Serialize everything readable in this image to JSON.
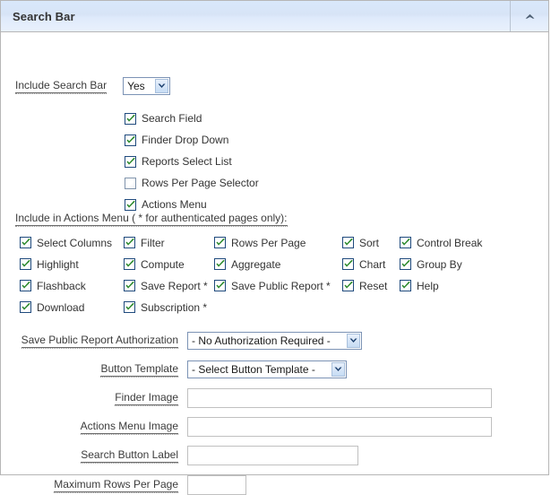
{
  "region": {
    "title": "Search Bar",
    "collapse_icon": "chevron-up-icon"
  },
  "include_search_bar": {
    "label": "Include Search Bar",
    "value": "Yes"
  },
  "top_checkboxes": [
    {
      "label": "Search Field",
      "checked": true
    },
    {
      "label": "Finder Drop Down",
      "checked": true
    },
    {
      "label": "Reports Select List",
      "checked": true
    },
    {
      "label": "Rows Per Page Selector",
      "checked": false
    },
    {
      "label": "Actions Menu",
      "checked": true
    }
  ],
  "actions_menu": {
    "heading": "Include in Actions Menu ( * for authenticated pages only):",
    "rows": [
      [
        {
          "label": "Select Columns",
          "checked": true
        },
        {
          "label": "Filter",
          "checked": true
        },
        {
          "label": "Rows Per Page",
          "checked": true
        },
        {
          "label": "Sort",
          "checked": true
        },
        {
          "label": "Control Break",
          "checked": true
        }
      ],
      [
        {
          "label": "Highlight",
          "checked": true
        },
        {
          "label": "Compute",
          "checked": true
        },
        {
          "label": "Aggregate",
          "checked": true
        },
        {
          "label": "Chart",
          "checked": true
        },
        {
          "label": "Group By",
          "checked": true
        }
      ],
      [
        {
          "label": "Flashback",
          "checked": true
        },
        {
          "label": "Save Report *",
          "checked": true
        },
        {
          "label": "Save Public Report *",
          "checked": true
        },
        {
          "label": "Reset",
          "checked": true
        },
        {
          "label": "Help",
          "checked": true
        }
      ],
      [
        {
          "label": "Download",
          "checked": true
        },
        {
          "label": "Subscription *",
          "checked": true
        }
      ]
    ]
  },
  "save_public_report_authorization": {
    "label": "Save Public Report Authorization",
    "value": "- No Authorization Required -"
  },
  "button_template": {
    "label": "Button Template",
    "value": "- Select Button Template -"
  },
  "finder_image": {
    "label": "Finder Image",
    "value": "",
    "placeholder": ""
  },
  "actions_menu_image": {
    "label": "Actions Menu Image",
    "value": "",
    "placeholder": ""
  },
  "search_button_label": {
    "label": "Search Button Label",
    "value": "",
    "placeholder": ""
  },
  "maximum_rows_per_page": {
    "label": "Maximum Rows Per Page",
    "value": "",
    "placeholder": ""
  },
  "colors": {
    "header_top": "#d9e8fb",
    "header_bottom": "#e9f1fc",
    "panel_border": "#b6b6b6",
    "check_green": "#2d8a2d",
    "check_border": "#1f4a7d",
    "select_border": "#7c93b5",
    "input_border": "#c0c0c0"
  }
}
